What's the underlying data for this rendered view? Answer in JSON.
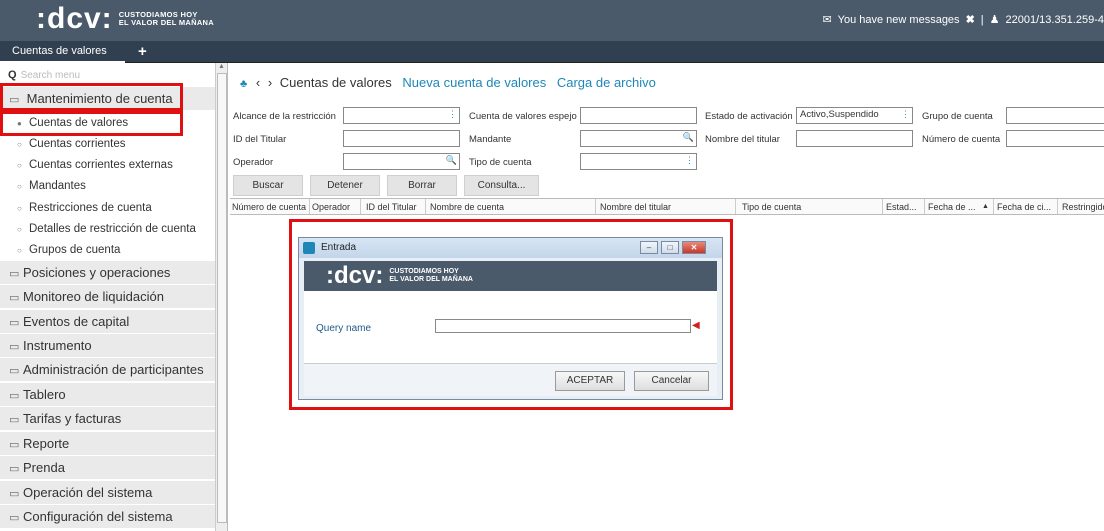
{
  "header": {
    "logo_mark": ":dcv:",
    "logo_tag_line1": "CUSTODIAMOS HOY",
    "logo_tag_line2": "EL VALOR DEL MAÑANA",
    "messages": "You have new messages",
    "user": "22001/13.351.259-4"
  },
  "tabs": {
    "active": "Cuentas de valores",
    "add": "+"
  },
  "sidebar": {
    "search_placeholder": "Search menu",
    "group_open": "Mantenimiento de cuenta",
    "subitems": [
      "Cuentas de valores",
      "Cuentas corrientes",
      "Cuentas corrientes externas",
      "Mandantes",
      "Restricciones de cuenta",
      "Detalles de restricción de cuenta",
      "Grupos de cuenta"
    ],
    "categories": [
      "Posiciones y operaciones",
      "Monitoreo de liquidación",
      "Eventos de capital",
      "Instrumento",
      "Administración de participantes",
      "Tablero",
      "Tarifas y facturas",
      "Reporte",
      "Prenda",
      "Operación del sistema",
      "Configuración del sistema"
    ]
  },
  "breadcrumb": {
    "current": "Cuentas de valores",
    "link1": "Nueva cuenta de valores",
    "link2": "Carga de archivo"
  },
  "form": {
    "alcance_label": "Alcance de la restricción",
    "espejo_label": "Cuenta de valores espejo",
    "estado_label": "Estado de activación",
    "estado_value": "Activo,Suspendido",
    "grupo_label": "Grupo de cuenta",
    "titular_label": "ID del Titular",
    "mandante_label": "Mandante",
    "nombre_titular_label": "Nombre del titular",
    "numero_label": "Número de cuenta",
    "operador_label": "Operador",
    "tipo_label": "Tipo de cuenta"
  },
  "buttons": {
    "buscar": "Buscar",
    "detener": "Detener",
    "borrar": "Borrar",
    "consulta": "Consulta..."
  },
  "grid": {
    "columns": [
      "Número de cuenta",
      "Operador",
      "ID del Titular",
      "Nombre de cuenta",
      "Nombre del titular",
      "Tipo de cuenta",
      "Estad...",
      "Fecha de ...",
      "Fecha de ci...",
      "Restringido"
    ]
  },
  "dialog": {
    "title": "Entrada",
    "query_label": "Query name",
    "query_value": "",
    "accept": "ACEPTAR",
    "cancel": "Cancelar"
  },
  "colors": {
    "accent": "#1e87b8",
    "header": "#4a5a6a",
    "highlight": "#e01010"
  }
}
